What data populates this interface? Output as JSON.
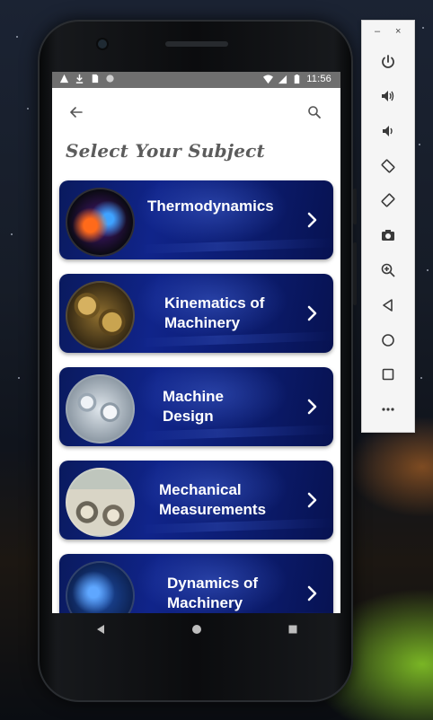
{
  "status_bar": {
    "time": "11:56"
  },
  "app": {
    "title": "Select Your Subject"
  },
  "subjects": [
    {
      "label": "Thermodynamics"
    },
    {
      "label": "Kinematics of Machinery"
    },
    {
      "label": "Machine Design"
    },
    {
      "label": "Mechanical Measurements"
    },
    {
      "label": "Dynamics of Machinery"
    }
  ],
  "emulator": {
    "minimize": "–",
    "close": "×",
    "tools": [
      "power-icon",
      "volume-up-icon",
      "volume-down-icon",
      "rotate-left-icon",
      "rotate-right-icon",
      "camera-icon",
      "zoom-icon",
      "back-icon",
      "home-icon",
      "overview-icon",
      "more-icon"
    ]
  },
  "colors": {
    "card_blue": "#10248a",
    "title_gray": "#5c5c5c",
    "status_bar": "#6f6f6f"
  }
}
